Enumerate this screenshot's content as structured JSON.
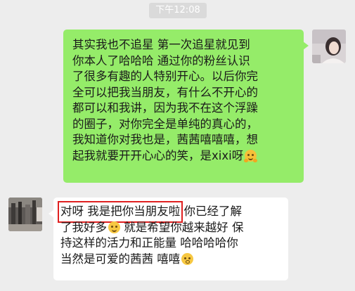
{
  "timestamp": "下午12:08",
  "messages": {
    "outgoing": {
      "lines": [
        "其实我也不追星 第一次追星就见到",
        "你本人了哈哈哈 通过你的粉丝认识",
        "了很多有趣的人特别开心。以后你完",
        "全可以把我当朋友，有什么不开心的",
        "都可以和我讲，因为我不在这个浮躁",
        "的圈子，对你完全是单纯的真心的，",
        "我知道你对我也是，茜茜嘻嘻嘻，想",
        "起我就要开开心心的笑，是xixi呀"
      ],
      "emoji": "hugging-face"
    },
    "incoming": {
      "highlight": "对呀 我是把你当朋友啦",
      "line1_rest": "你已经了解",
      "line2": "了我好多",
      "line2_rest": "就是希望你越来越好 保",
      "line3": "持这样的活力和正能量 哈哈哈哈你",
      "line4": "当然是可爱的茜茜 嘻嘻",
      "emojis": [
        "smiling-face",
        "shy-face"
      ]
    }
  },
  "colors": {
    "background": "#ededed",
    "outgoing_bubble": "#95ec69",
    "incoming_bubble": "#ffffff",
    "highlight_box": "#e02020"
  }
}
